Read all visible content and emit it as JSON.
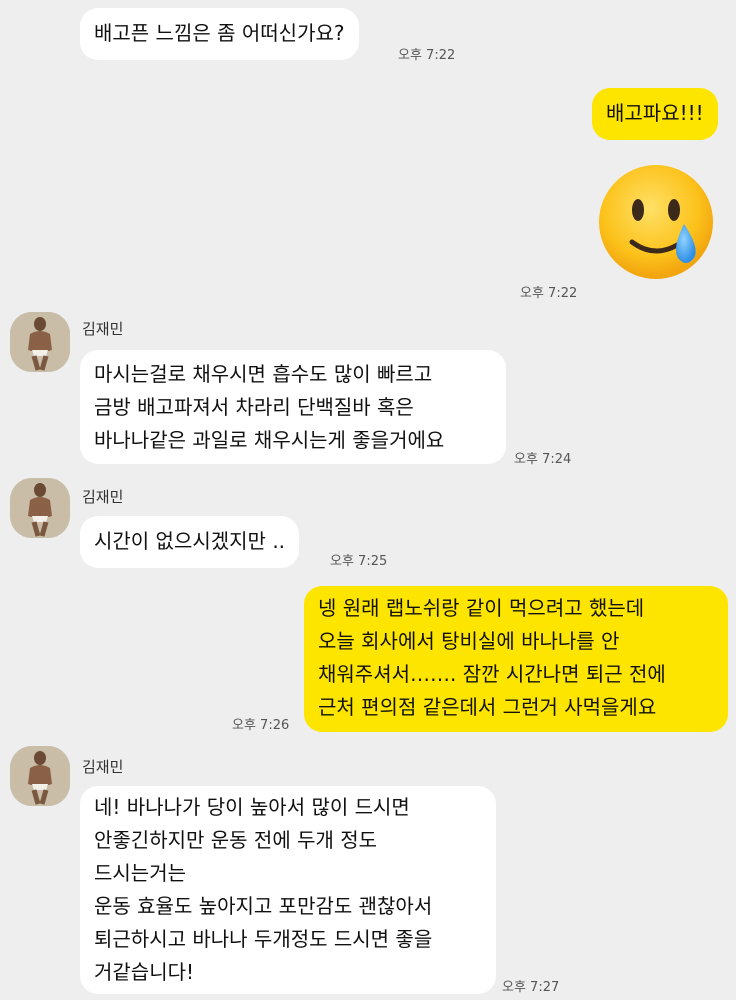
{
  "messages": [
    {
      "id": "m1",
      "side": "received",
      "text": [
        "배고픈 느낌은 좀 어떠신가요?"
      ],
      "time": "오후 7:22"
    },
    {
      "id": "m2",
      "side": "sent",
      "text": [
        "배고파요!!!"
      ]
    },
    {
      "id": "m3",
      "side": "sent",
      "emoji": "smiling-face-with-tear-emoji",
      "time": "오후 7:22"
    },
    {
      "id": "m4",
      "side": "received",
      "sender": "김재민",
      "text": [
        "마시는걸로 채우시면 흡수도 많이 빠르고",
        "금방 배고파져서 차라리 단백질바 혹은",
        "바나나같은 과일로 채우시는게 좋을거에요"
      ],
      "time": "오후 7:24"
    },
    {
      "id": "m5",
      "side": "received",
      "sender": "김재민",
      "text": [
        "시간이 없으시겠지만 .."
      ],
      "time": "오후 7:25"
    },
    {
      "id": "m6",
      "side": "sent",
      "text": [
        "넹 원래 랩노쉬랑 같이 먹으려고 했는데",
        "오늘 회사에서 탕비실에 바나나를 안",
        "채워주셔서……. 잠깐 시간나면 퇴근 전에",
        "근처 편의점 같은데서 그런거 사먹을게요"
      ],
      "time": "오후 7:26"
    },
    {
      "id": "m7",
      "side": "received",
      "sender": "김재민",
      "text": [
        "네! 바나나가 당이 높아서 많이 드시면",
        "안좋긴하지만 운동 전에 두개 정도",
        "드시는거는",
        "운동 효율도 높아지고 포만감도 괜찮아서",
        "퇴근하시고 바나나 두개정도 드시면 좋을",
        "거같습니다!"
      ],
      "time": "오후 7:27"
    }
  ],
  "colors": {
    "background": "#eeeeee",
    "received_bubble": "#ffffff",
    "sent_bubble": "#fee500"
  }
}
